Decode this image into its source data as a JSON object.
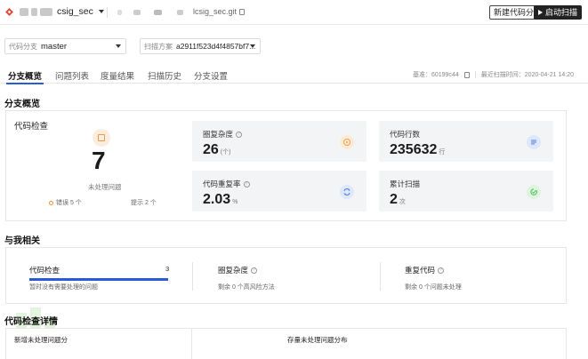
{
  "topbar": {
    "repo_name": "csig_sec",
    "git_url": "lcsig_sec.git",
    "new_analysis_label": "新建代码分析",
    "start_scan_label": "启动扫描"
  },
  "filters": {
    "branch_label": "代码分支",
    "branch_value": "master",
    "scheme_label": "扫描方案",
    "scheme_value": "a2911f523d4f4857bf7..."
  },
  "tabs": [
    "分支概览",
    "问题列表",
    "度量结果",
    "扫描历史",
    "分支设置"
  ],
  "base_info": {
    "base": "基准：60199c44",
    "last_scan": "最近扫描时间：2020-04-21 14:20"
  },
  "overview": {
    "section_title": "分支概览",
    "code_check": {
      "title": "代码检查",
      "count": "7",
      "count_label": "未处理问题",
      "errors": "错误 5 个",
      "hints": "提示 2 个"
    },
    "stats": [
      {
        "title": "圈复杂度",
        "value": "26",
        "unit": "(个)",
        "icon": "target-icon",
        "color": "#f5a04a",
        "bg": "#fdebd8"
      },
      {
        "title": "代码行数",
        "value": "235632",
        "unit": "行",
        "icon": "list-icon",
        "color": "#4a7be0",
        "bg": "#dfe8fa"
      },
      {
        "title": "代码重复率",
        "value": "2.03",
        "unit": "%",
        "icon": "refresh-icon",
        "color": "#4a7be0",
        "bg": "#dfe8fa"
      },
      {
        "title": "累计扫描",
        "value": "2",
        "unit": "次",
        "icon": "check-circle-icon",
        "color": "#4cbf59",
        "bg": "#dff3df"
      }
    ]
  },
  "related": {
    "section_title": "与我相关",
    "code_check": {
      "title": "代码检查",
      "count": "3",
      "sub": "暂时没有需要处理的问题",
      "progress": 1.0
    },
    "complexity": {
      "title": "圈复杂度",
      "sub": "剩余 0 个高风险方法"
    },
    "duplicate": {
      "title": "重复代码",
      "sub": "剩余 0 个问题未处理"
    }
  },
  "detail": {
    "section_title": "代码检查详情",
    "new_issues_label": "新增未处理问题分",
    "stock_issues_label": "存量未处理问题分布"
  }
}
